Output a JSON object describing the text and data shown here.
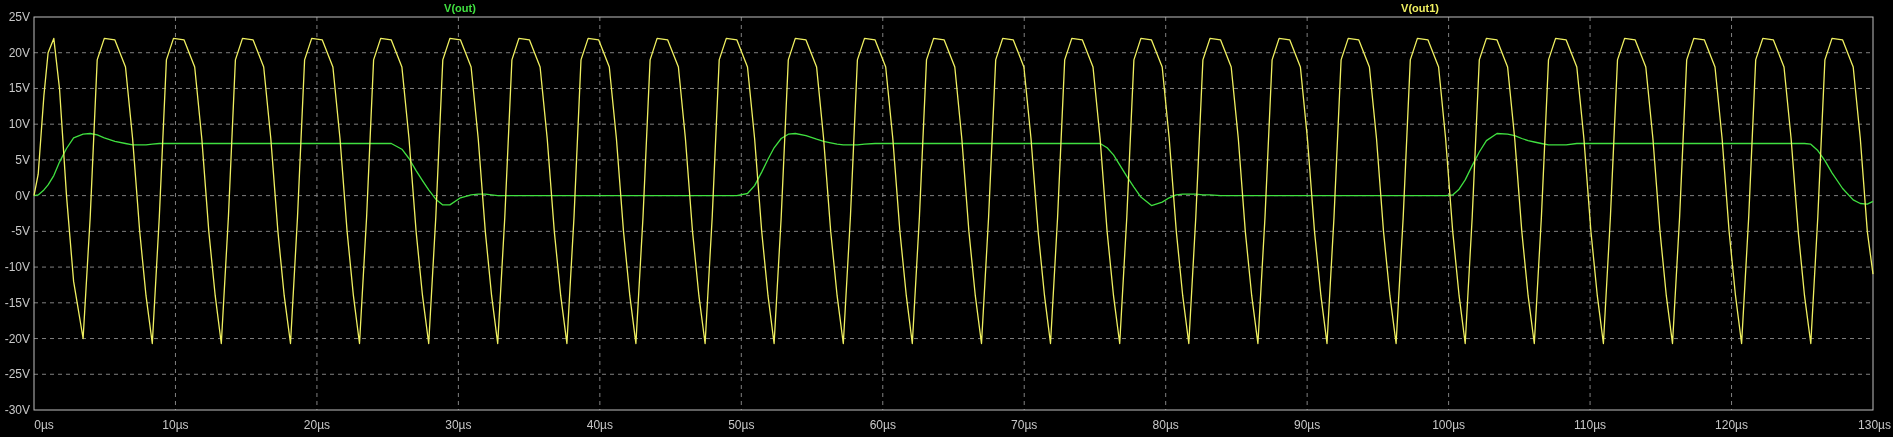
{
  "chart_data": {
    "type": "line",
    "grid": true,
    "xlim": [
      0,
      130
    ],
    "ylim": [
      -30,
      25
    ],
    "xticks": [
      {
        "value": 0,
        "label": "0µs"
      },
      {
        "value": 10,
        "label": "10µs"
      },
      {
        "value": 20,
        "label": "20µs"
      },
      {
        "value": 30,
        "label": "30µs"
      },
      {
        "value": 40,
        "label": "40µs"
      },
      {
        "value": 50,
        "label": "50µs"
      },
      {
        "value": 60,
        "label": "60µs"
      },
      {
        "value": 70,
        "label": "70µs"
      },
      {
        "value": 80,
        "label": "80µs"
      },
      {
        "value": 90,
        "label": "90µs"
      },
      {
        "value": 100,
        "label": "100µs"
      },
      {
        "value": 110,
        "label": "110µs"
      },
      {
        "value": 120,
        "label": "120µs"
      },
      {
        "value": 130,
        "label": "130µs"
      }
    ],
    "yticks": [
      {
        "value": 25,
        "label": "25V"
      },
      {
        "value": 20,
        "label": "20V"
      },
      {
        "value": 15,
        "label": "15V"
      },
      {
        "value": 10,
        "label": "10V"
      },
      {
        "value": 5,
        "label": "5V"
      },
      {
        "value": 0,
        "label": "0V"
      },
      {
        "value": -5,
        "label": "-5V"
      },
      {
        "value": -10,
        "label": "-10V"
      },
      {
        "value": -15,
        "label": "-15V"
      },
      {
        "value": -20,
        "label": "-20V"
      },
      {
        "value": -25,
        "label": "-25V"
      },
      {
        "value": -30,
        "label": "-30V"
      }
    ],
    "x": [
      0,
      0.3,
      0.7,
      1.0,
      1.4,
      1.8,
      2.3,
      2.8,
      3.47,
      3.97,
      4.47,
      4.97,
      5.72,
      6.47,
      6.97,
      7.47,
      7.92,
      8.36,
      8.86,
      9.36,
      9.86,
      10.61,
      11.36,
      11.86,
      12.36,
      12.81,
      13.24,
      13.74,
      14.24,
      14.74,
      15.49,
      16.24,
      16.74,
      17.24,
      17.69,
      18.13,
      18.63,
      19.13,
      19.63,
      20.38,
      21.13,
      21.63,
      22.13,
      22.58,
      23.01,
      23.51,
      24.01,
      24.51,
      25.26,
      26.01,
      26.51,
      27.01,
      27.46,
      27.9,
      28.4,
      28.9,
      29.4,
      30.15,
      30.9,
      31.4,
      31.9,
      32.35,
      32.78,
      33.28,
      33.78,
      34.28,
      35.03,
      35.78,
      36.28,
      36.78,
      37.23,
      37.67,
      38.17,
      38.67,
      39.17,
      39.92,
      40.67,
      41.17,
      41.67,
      42.12,
      42.55,
      43.05,
      43.55,
      44.05,
      44.8,
      45.55,
      46.05,
      46.55,
      47.0,
      47.44,
      47.94,
      48.44,
      48.94,
      49.69,
      50.44,
      50.94,
      51.44,
      51.89,
      52.32,
      52.82,
      53.32,
      53.82,
      54.57,
      55.32,
      55.82,
      56.32,
      56.77,
      57.21,
      57.71,
      58.21,
      58.71,
      59.46,
      60.21,
      60.71,
      61.21,
      61.66,
      62.09,
      62.59,
      63.09,
      63.59,
      64.34,
      65.09,
      65.59,
      66.09,
      66.54,
      66.98,
      67.48,
      67.98,
      68.48,
      69.23,
      69.98,
      70.48,
      70.98,
      71.43,
      71.86,
      72.36,
      72.86,
      73.36,
      74.11,
      74.86,
      75.36,
      75.86,
      76.31,
      76.75,
      77.25,
      77.75,
      78.25,
      79.0,
      79.75,
      80.25,
      80.75,
      81.2,
      81.63,
      82.13,
      82.63,
      83.13,
      83.88,
      84.63,
      85.13,
      85.63,
      86.08,
      86.52,
      87.02,
      87.52,
      88.02,
      88.77,
      89.52,
      90.02,
      90.52,
      90.97,
      91.4,
      91.9,
      92.4,
      92.9,
      93.65,
      94.4,
      94.9,
      95.4,
      95.85,
      96.29,
      96.79,
      97.29,
      97.79,
      98.54,
      99.29,
      99.79,
      100.29,
      100.74,
      101.17,
      101.67,
      102.17,
      102.67,
      103.42,
      104.17,
      104.67,
      105.17,
      105.62,
      106.06,
      106.56,
      107.06,
      107.56,
      108.31,
      109.06,
      109.56,
      110.06,
      110.51,
      110.94,
      111.44,
      111.94,
      112.44,
      113.19,
      113.94,
      114.44,
      114.94,
      115.39,
      115.83,
      116.33,
      116.83,
      117.33,
      118.08,
      118.83,
      119.33,
      119.83,
      120.28,
      120.71,
      121.21,
      121.71,
      122.21,
      122.96,
      123.71,
      124.21,
      124.71,
      125.16,
      125.6,
      126.1,
      126.6,
      127.1,
      127.85,
      128.6,
      129.1,
      129.6,
      130
    ],
    "series": [
      {
        "name": "V(out)",
        "color": "#40e040",
        "values": [
          0,
          0.1,
          0.8,
          1.5,
          2.8,
          4.7,
          6.6,
          8.1,
          8.6,
          8.7,
          8.5,
          8.1,
          7.6,
          7.3,
          7.1,
          7.1,
          7.1,
          7.2,
          7.3,
          7.3,
          7.3,
          7.3,
          7.3,
          7.3,
          7.3,
          7.3,
          7.3,
          7.3,
          7.3,
          7.3,
          7.3,
          7.3,
          7.3,
          7.3,
          7.3,
          7.3,
          7.3,
          7.3,
          7.3,
          7.3,
          7.3,
          7.3,
          7.3,
          7.3,
          7.3,
          7.3,
          7.3,
          7.3,
          7.3,
          6.5,
          5.2,
          3.5,
          2.1,
          0.8,
          -0.5,
          -1.3,
          -1.3,
          -0.3,
          0.1,
          0.2,
          0.2,
          0.1,
          0,
          0,
          0,
          0,
          0,
          0,
          0,
          0,
          0,
          0,
          0,
          0,
          0,
          0,
          0,
          0,
          0,
          0,
          0,
          0,
          0,
          0,
          0,
          0,
          0,
          0,
          0,
          0,
          0,
          0,
          0,
          0,
          0.3,
          1.4,
          3.3,
          5.1,
          6.7,
          8.0,
          8.6,
          8.7,
          8.4,
          7.9,
          7.6,
          7.4,
          7.2,
          7.1,
          7.1,
          7.1,
          7.2,
          7.3,
          7.3,
          7.3,
          7.3,
          7.3,
          7.3,
          7.3,
          7.3,
          7.3,
          7.3,
          7.3,
          7.3,
          7.3,
          7.3,
          7.3,
          7.3,
          7.3,
          7.3,
          7.3,
          7.3,
          7.3,
          7.3,
          7.3,
          7.3,
          7.3,
          7.3,
          7.3,
          7.3,
          7.3,
          7.3,
          6.7,
          5.7,
          4.3,
          2.7,
          1.2,
          -0.2,
          -1.4,
          -0.9,
          -0.3,
          0.1,
          0.2,
          0.2,
          0.2,
          0.1,
          0.1,
          0,
          0,
          0,
          0,
          0,
          0,
          0,
          0,
          0,
          0,
          0,
          0,
          0,
          0,
          0,
          0,
          0,
          0,
          0,
          0,
          0,
          0,
          0,
          0,
          0,
          0,
          0,
          0,
          0,
          0,
          0.1,
          0.9,
          2.2,
          4.2,
          6.1,
          7.7,
          8.7,
          8.6,
          8.4,
          8.0,
          7.7,
          7.5,
          7.3,
          7.1,
          7.1,
          7.1,
          7.3,
          7.3,
          7.3,
          7.3,
          7.3,
          7.3,
          7.3,
          7.3,
          7.3,
          7.3,
          7.3,
          7.3,
          7.3,
          7.3,
          7.3,
          7.3,
          7.3,
          7.3,
          7.3,
          7.3,
          7.3,
          7.3,
          7.3,
          7.3,
          7.3,
          7.3,
          7.3,
          7.3,
          7.3,
          7.3,
          7.3,
          7.2,
          6.3,
          4.9,
          3.2,
          1.0,
          -0.6,
          -1.1,
          -1.2,
          -0.8
        ]
      },
      {
        "name": "V(out1)",
        "color": "#f0f060",
        "values": [
          0,
          3,
          14,
          20,
          22,
          15,
          0,
          -12,
          -20,
          -3,
          19,
          22,
          21.8,
          18,
          8,
          -5,
          -14,
          -20.7,
          -3,
          19,
          22,
          21.8,
          18,
          8,
          -5,
          -14,
          -20.7,
          -3,
          19,
          22,
          21.8,
          18,
          8,
          -5,
          -14,
          -20.7,
          -3,
          19,
          22,
          21.8,
          18,
          8,
          -5,
          -14,
          -20.7,
          -3,
          19,
          22,
          21.8,
          18,
          8,
          -5,
          -14,
          -20.7,
          -3,
          19,
          22,
          21.8,
          18,
          8,
          -5,
          -14,
          -20.7,
          -3,
          19,
          22,
          21.8,
          18,
          8,
          -5,
          -14,
          -20.7,
          -3,
          19,
          22,
          21.8,
          18,
          8,
          -5,
          -14,
          -20.7,
          -3,
          19,
          22,
          21.8,
          18,
          8,
          -5,
          -14,
          -20.7,
          -3,
          19,
          22,
          21.8,
          18,
          8,
          -5,
          -14,
          -20.7,
          -3,
          19,
          22,
          21.8,
          18,
          8,
          -5,
          -14,
          -20.7,
          -3,
          19,
          22,
          21.8,
          18,
          8,
          -5,
          -14,
          -20.7,
          -3,
          19,
          22,
          21.8,
          18,
          8,
          -5,
          -14,
          -20.7,
          -3,
          19,
          22,
          21.8,
          18,
          8,
          -5,
          -14,
          -20.7,
          -3,
          19,
          22,
          21.8,
          18,
          8,
          -5,
          -14,
          -20.7,
          -3,
          19,
          22,
          21.8,
          18,
          8,
          -5,
          -14,
          -20.7,
          -3,
          19,
          22,
          21.8,
          18,
          8,
          -5,
          -14,
          -20.7,
          -3,
          19,
          22,
          21.8,
          18,
          8,
          -5,
          -14,
          -20.7,
          -3,
          19,
          22,
          21.8,
          18,
          8,
          -5,
          -14,
          -20.7,
          -3,
          19,
          22,
          21.8,
          18,
          8,
          -5,
          -14,
          -20.7,
          -3,
          19,
          22,
          21.8,
          18,
          8,
          -5,
          -14,
          -20.7,
          -3,
          19,
          22,
          21.8,
          18,
          8,
          -5,
          -14,
          -20.7,
          -3,
          19,
          22,
          21.8,
          18,
          8,
          -5,
          -14,
          -20.7,
          -3,
          19,
          22,
          21.8,
          18,
          8,
          -5,
          -14,
          -20.7,
          -3,
          19,
          22,
          21.8,
          18,
          8,
          -5,
          -14,
          -20.7,
          -3,
          19,
          22,
          21.8,
          18,
          8,
          -5,
          -11
        ]
      }
    ]
  }
}
